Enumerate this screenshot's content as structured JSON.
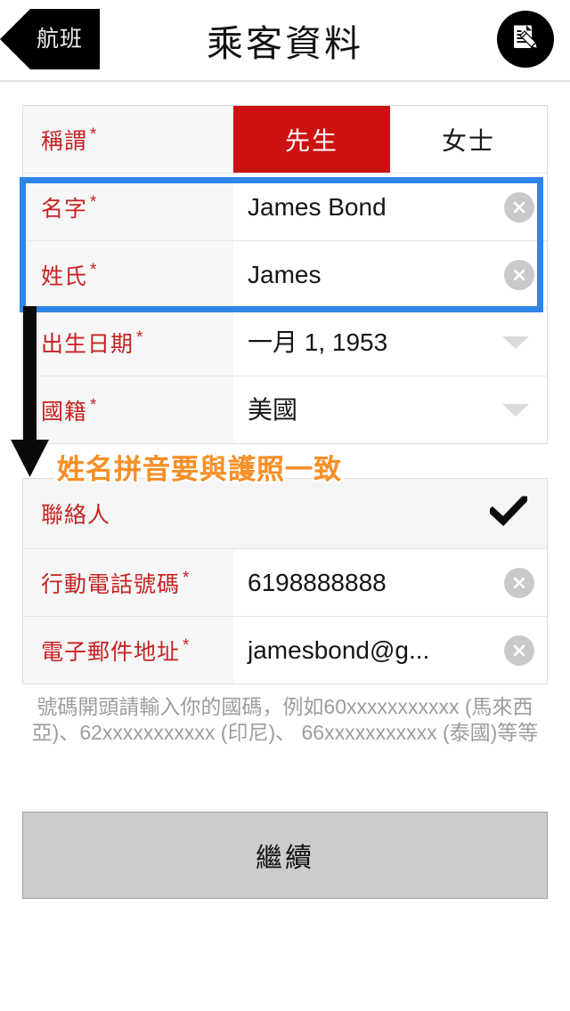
{
  "header": {
    "back_label": "航班",
    "title": "乘客資料",
    "edit_icon": "document-edit-icon"
  },
  "personal_section": {
    "title_row": {
      "label": "稱謂",
      "required_mark": "*",
      "options": [
        {
          "label": "先生",
          "selected": true
        },
        {
          "label": "女士",
          "selected": false
        }
      ]
    },
    "fields": [
      {
        "label": "名字",
        "required_mark": "*",
        "value": "James Bond",
        "control": "clear",
        "name": "first-name"
      },
      {
        "label": "姓氏",
        "required_mark": "*",
        "value": "James",
        "control": "clear",
        "name": "last-name"
      },
      {
        "label": "出生日期",
        "required_mark": "*",
        "value": "一月 1, 1953",
        "control": "dropdown",
        "name": "date-of-birth"
      },
      {
        "label": "國籍",
        "required_mark": "*",
        "value": "美國",
        "control": "dropdown",
        "name": "nationality"
      }
    ]
  },
  "contact_section": {
    "head": {
      "label": "聯絡人",
      "control": "check"
    },
    "fields": [
      {
        "label": "行動電話號碼",
        "required_mark": "*",
        "value": "6198888888",
        "control": "clear",
        "name": "mobile-phone"
      },
      {
        "label": "電子郵件地址",
        "required_mark": "*",
        "value": "jamesbond@g...",
        "control": "clear",
        "name": "email-address"
      }
    ]
  },
  "helper_text": "號碼開頭請輸入你的國碼，例如60xxxxxxxxxxx (馬來西亞)、62xxxxxxxxxxx (印尼)、 66xxxxxxxxxxx (泰國)等等",
  "continue_button": {
    "label": "繼續"
  },
  "annotations": {
    "highlight_note": "姓名拼音要與護照一致",
    "highlight_color": "#2e86e8",
    "note_color": "#f79028",
    "arrow_color": "#000000"
  },
  "colors": {
    "accent_red": "#cc1111",
    "label_red": "#c62222",
    "row_label_bg": "#f7f7f7",
    "helper_gray": "#9d9d9d",
    "button_gray": "#cccccc"
  }
}
